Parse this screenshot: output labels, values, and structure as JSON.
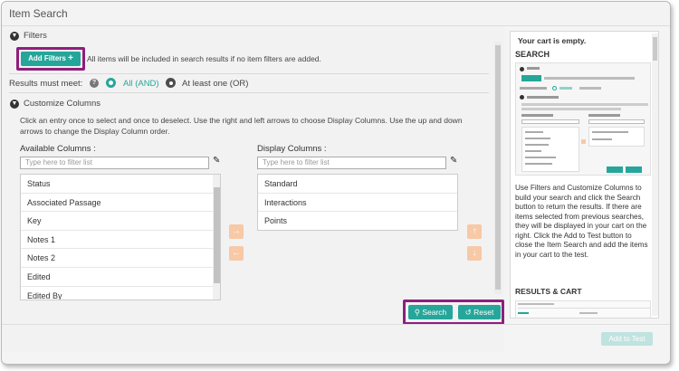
{
  "window": {
    "title": "Item Search"
  },
  "filters": {
    "label": "Filters",
    "add_button": "Add Filters",
    "add_icon": "+",
    "note": "All items will be included in search results if no item filters are added."
  },
  "results": {
    "label": "Results must meet:",
    "help_icon": "?",
    "option_all": "All (AND)",
    "option_any": "At least one (OR)",
    "selected": "All (AND)"
  },
  "columns": {
    "label": "Customize Columns",
    "instructions": "Click an entry once to select and once to deselect. Use the right and left arrows to choose Display Columns. Use the up and down arrows to change the Display Column order.",
    "available_label": "Available Columns :",
    "display_label": "Display Columns :",
    "filter_placeholder": "Type here to filter list",
    "available": [
      "Status",
      "Associated Passage",
      "Key",
      "Notes 1",
      "Notes 2",
      "Edited",
      "Edited By"
    ],
    "display": [
      "Standard",
      "Interactions",
      "Points"
    ]
  },
  "actions": {
    "search": "Search",
    "reset": "Reset"
  },
  "cart": {
    "empty": "Your cart is empty.",
    "search_heading": "SEARCH",
    "help_text": "Use Filters and Customize Columns to build your search and click the Search button to return the results. If there are items selected from previous searches, they will be displayed in your cart on the right. Click the Add to Test button to close the Item Search and add the items in your cart to the test.",
    "results_heading": "RESULTS & CART"
  },
  "footer": {
    "add_to_test": "Add to Test"
  },
  "colors": {
    "accent": "#26a69a",
    "highlight": "#8e1e7d",
    "arrow": "#f7c9a6"
  }
}
